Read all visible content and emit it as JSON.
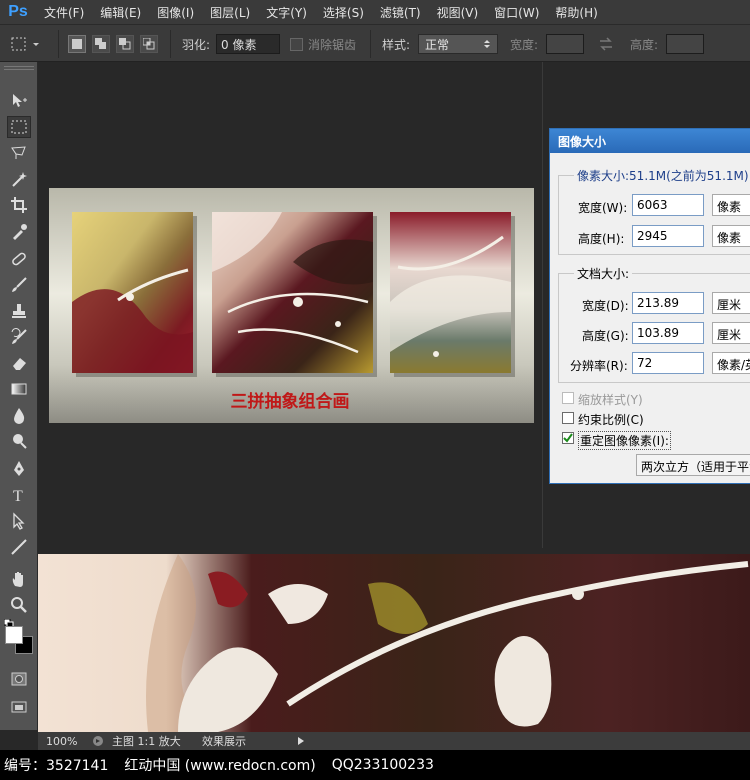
{
  "app": {
    "logo": "Ps"
  },
  "menu": [
    "文件(F)",
    "编辑(E)",
    "图像(I)",
    "图层(L)",
    "文字(Y)",
    "选择(S)",
    "滤镜(T)",
    "视图(V)",
    "窗口(W)",
    "帮助(H)"
  ],
  "options": {
    "feather_label": "羽化:",
    "feather_value": "0 像素",
    "antialias_label": "消除锯齿",
    "style_label": "样式:",
    "style_value": "正常",
    "width_label": "宽度:",
    "height_label": "高度:"
  },
  "canvas": {
    "caption": "三拼抽象组合画"
  },
  "dialog": {
    "title": "图像大小",
    "pixel_legend": "像素大小:51.1M(之前为51.1M)",
    "pixel_width_label": "宽度(W):",
    "pixel_width_value": "6063",
    "pixel_width_unit": "像素",
    "pixel_height_label": "高度(H):",
    "pixel_height_value": "2945",
    "pixel_height_unit": "像素",
    "doc_legend": "文档大小:",
    "doc_width_label": "宽度(D):",
    "doc_width_value": "213.89",
    "doc_width_unit": "厘米",
    "doc_height_label": "高度(G):",
    "doc_height_value": "103.89",
    "doc_height_unit": "厘米",
    "resolution_label": "分辨率(R):",
    "resolution_value": "72",
    "resolution_unit": "像素/英寸",
    "scale_styles_label": "缩放样式(Y)",
    "constrain_label": "约束比例(C)",
    "resample_label": "重定图像像素(I):",
    "resample_method": "两次立方（适用于平滑渐变）"
  },
  "status": {
    "zoom": "100%",
    "doc_info": "主图 1:1 放大",
    "doc_info2": "效果展示"
  },
  "footer": {
    "id_text": "编号：3527141",
    "site_text": "红动中国 (www.redocn.com)",
    "qq_text": "QQ233100233"
  },
  "colors": {
    "accent": "#2f6fb6",
    "caption": "#c01818",
    "ps_blue": "#3ea0ff"
  }
}
